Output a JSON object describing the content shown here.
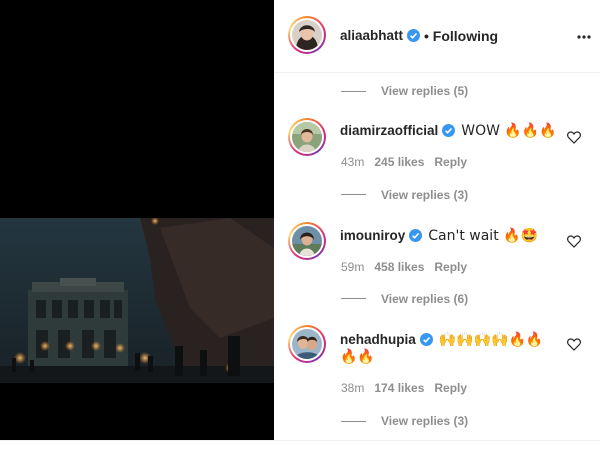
{
  "header": {
    "username": "aliaabhatt",
    "follow_status": "• Following"
  },
  "threads": [
    {
      "view_replies": "View replies (5)"
    },
    {
      "comment": {
        "username": "diamirzaofficial",
        "text": "WOW 🔥🔥🔥",
        "time": "43m",
        "likes": "245 likes",
        "reply": "Reply"
      },
      "view_replies": "View replies (3)"
    },
    {
      "comment": {
        "username": "imouniroy",
        "text": "Can't wait 🔥🤩",
        "time": "59m",
        "likes": "458 likes",
        "reply": "Reply"
      },
      "view_replies": "View replies (6)"
    },
    {
      "comment": {
        "username": "nehadhupia",
        "text": "🙌🙌🙌🙌🔥🔥",
        "text_line2": "🔥🔥",
        "time": "38m",
        "likes": "174 likes",
        "reply": "Reply"
      },
      "view_replies": "View replies (3)"
    }
  ],
  "icons": {
    "verified": "verified-badge-icon",
    "more": "more-options-icon",
    "like": "heart-icon"
  },
  "colors": {
    "verified_blue": "#3897f0",
    "muted_text": "#8e8e8e",
    "primary_text": "#262626"
  }
}
